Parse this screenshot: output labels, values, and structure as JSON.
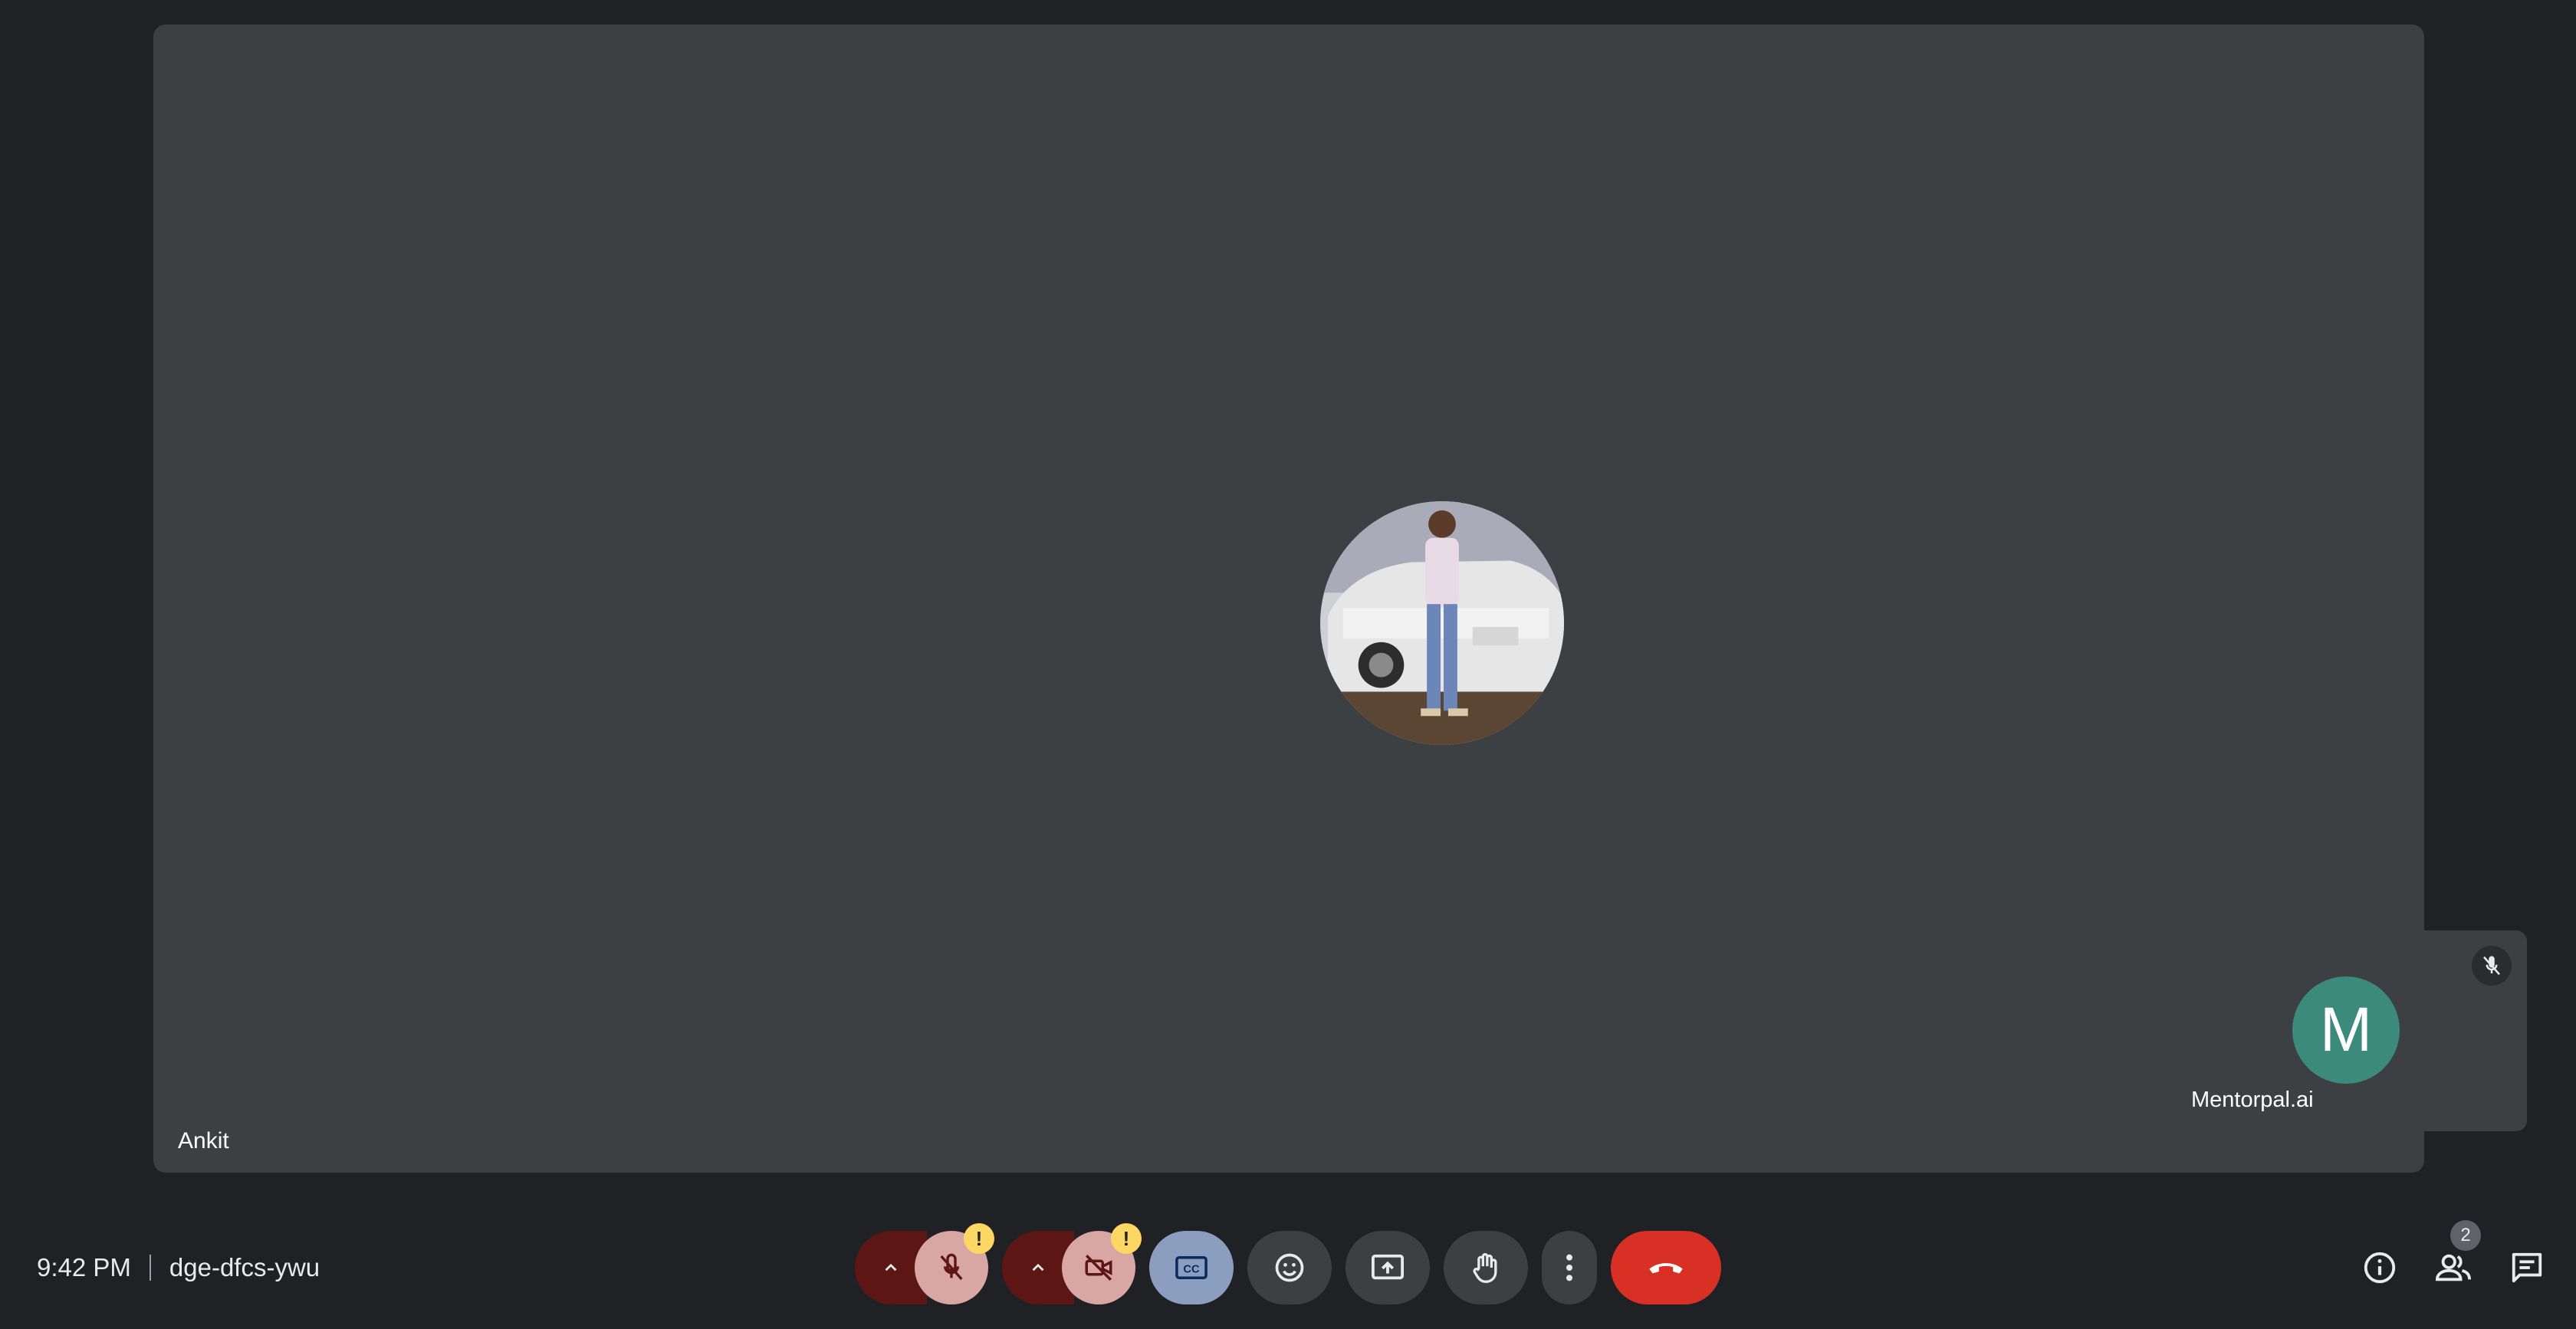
{
  "main_tile": {
    "participant_name": "Ankit"
  },
  "self_tile": {
    "participant_name": "Mentorpal.ai",
    "avatar_initial": "M",
    "avatar_color": "#3b8a7c"
  },
  "status": {
    "time": "9:42 PM",
    "meeting_code": "dge-dfcs-ywu"
  },
  "controls": {
    "mic_warning": "!",
    "camera_warning": "!",
    "icons": [
      "chevron-up-icon",
      "mic-off-icon",
      "chevron-up-icon",
      "camera-off-icon",
      "captions-icon",
      "emoji-icon",
      "present-screen-icon",
      "raise-hand-icon",
      "more-options-icon",
      "end-call-icon"
    ]
  },
  "right_panel": {
    "participants_count": "2"
  },
  "colors": {
    "end_call": "#d93025",
    "warning": "#fdd663",
    "tile_bg": "#3c4043"
  }
}
